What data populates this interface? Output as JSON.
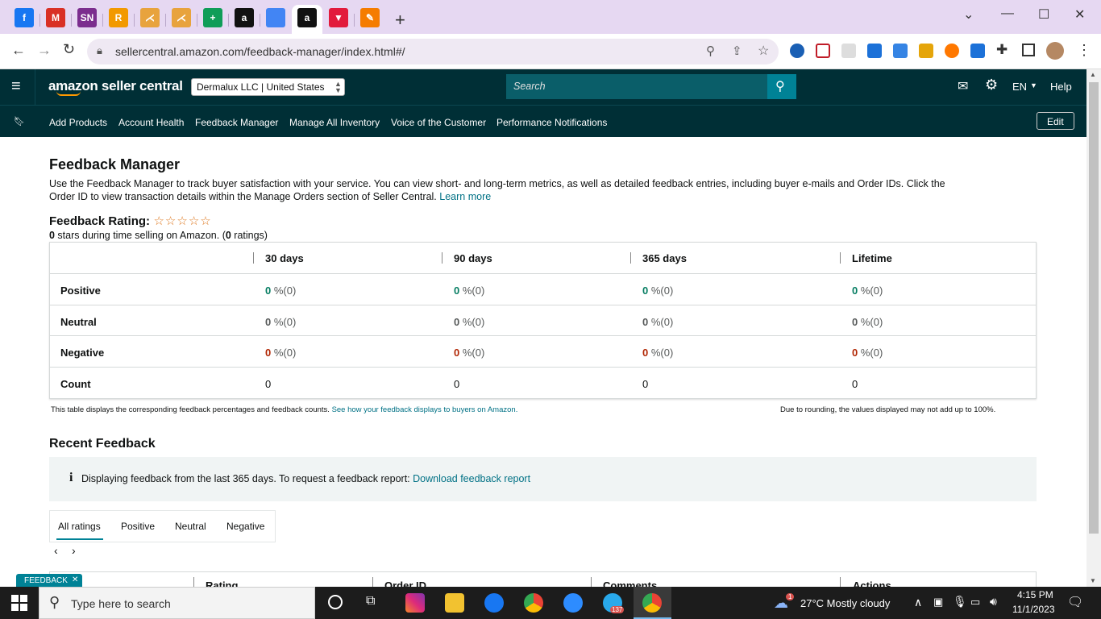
{
  "browser": {
    "url": "sellercentral.amazon.com/feedback-manager/index.html#/",
    "new_tab_label": "+",
    "tabs": [
      {
        "icon": "facebook-icon",
        "letter": "f",
        "color": "#1877f2"
      },
      {
        "icon": "gmail-icon",
        "letter": "M",
        "color": "#d93025"
      },
      {
        "icon": "sn-icon",
        "letter": "SN",
        "color": "#7b2d8e"
      },
      {
        "icon": "r-app-icon",
        "letter": "R",
        "color": "#f29900"
      },
      {
        "icon": "fan-icon",
        "letter": "⋌",
        "color": "#e8a33d"
      },
      {
        "icon": "fan-icon-2",
        "letter": "⋌",
        "color": "#e8a33d"
      },
      {
        "icon": "sheets-icon",
        "letter": "+",
        "color": "#0f9d58"
      },
      {
        "icon": "amazon-icon",
        "letter": "a",
        "color": "#111111"
      },
      {
        "icon": "multicolor-icon",
        "letter": "",
        "color": "#4285f4"
      },
      {
        "icon": "amazon-active-icon",
        "letter": "a",
        "color": "#111111"
      },
      {
        "icon": "red-triangle-icon",
        "letter": "▼",
        "color": "#e21b3c"
      },
      {
        "icon": "edit-app-icon",
        "letter": "✎",
        "color": "#f57c00"
      }
    ]
  },
  "header": {
    "logo_text": "amazon seller central",
    "account_selector": "Dermalux LLC | United States",
    "search_placeholder": "Search",
    "language": "EN",
    "help": "Help"
  },
  "nav": {
    "links": [
      "Add Products",
      "Account Health",
      "Feedback Manager",
      "Manage All Inventory",
      "Voice of the Customer",
      "Performance Notifications"
    ],
    "edit": "Edit"
  },
  "page": {
    "title": "Feedback Manager",
    "intro_line1": "Use the Feedback Manager to track buyer satisfaction with your service. You can view short- and long-term metrics, as well as detailed feedback entries, including buyer e-mails and Order IDs. Click the",
    "intro_line2": "Order ID to view transaction details within the Manage Orders section of Seller Central.",
    "learn_more": "Learn more",
    "rating_label": "Feedback Rating:",
    "stars_value": "0",
    "stars_text_1": " stars during time selling on Amazon. (",
    "ratings_count": "0",
    "stars_text_2": " ratings)",
    "rating_stars": 0
  },
  "metrics": {
    "columns": [
      "30 days",
      "90 days",
      "365 days",
      "Lifetime"
    ],
    "rows": [
      {
        "label": "Positive",
        "color": "#067d62",
        "cells": [
          {
            "num": "0",
            "rest": " %(0)"
          },
          {
            "num": "0",
            "rest": " %(0)"
          },
          {
            "num": "0",
            "rest": " %(0)"
          },
          {
            "num": "0",
            "rest": " %(0)"
          }
        ]
      },
      {
        "label": "Neutral",
        "color": "#565959",
        "cells": [
          {
            "num": "0",
            "rest": " %(0)"
          },
          {
            "num": "0",
            "rest": " %(0)"
          },
          {
            "num": "0",
            "rest": " %(0)"
          },
          {
            "num": "0",
            "rest": " %(0)"
          }
        ]
      },
      {
        "label": "Negative",
        "color": "#b12704",
        "cells": [
          {
            "num": "0",
            "rest": " %(0)"
          },
          {
            "num": "0",
            "rest": " %(0)"
          },
          {
            "num": "0",
            "rest": " %(0)"
          },
          {
            "num": "0",
            "rest": " %(0)"
          }
        ]
      },
      {
        "label": "Count",
        "color": "#0f1111",
        "cells": [
          {
            "num": "0",
            "rest": ""
          },
          {
            "num": "0",
            "rest": ""
          },
          {
            "num": "0",
            "rest": ""
          },
          {
            "num": "0",
            "rest": ""
          }
        ]
      }
    ],
    "footnote": "This table displays the corresponding feedback percentages and feedback counts.",
    "footnote_link": "See how your feedback displays to buyers on Amazon.",
    "rounding_note": "Due to rounding, the values displayed may not add up to 100%."
  },
  "recent": {
    "title": "Recent Feedback",
    "info_text": "Displaying feedback from the last 365 days. To request a feedback report:",
    "download_link": "Download feedback report",
    "tabs": [
      "All ratings",
      "Positive",
      "Neutral",
      "Negative"
    ],
    "columns": [
      "Rating",
      "Order ID",
      "Comments",
      "Actions"
    ],
    "feedback_badge": "FEEDBACK"
  },
  "taskbar": {
    "search_placeholder": "Type here to search",
    "weather": "27°C  Mostly cloudy",
    "weather_badge": "1",
    "telegram_badge": "137",
    "time": "4:15 PM",
    "date": "11/1/2023"
  }
}
